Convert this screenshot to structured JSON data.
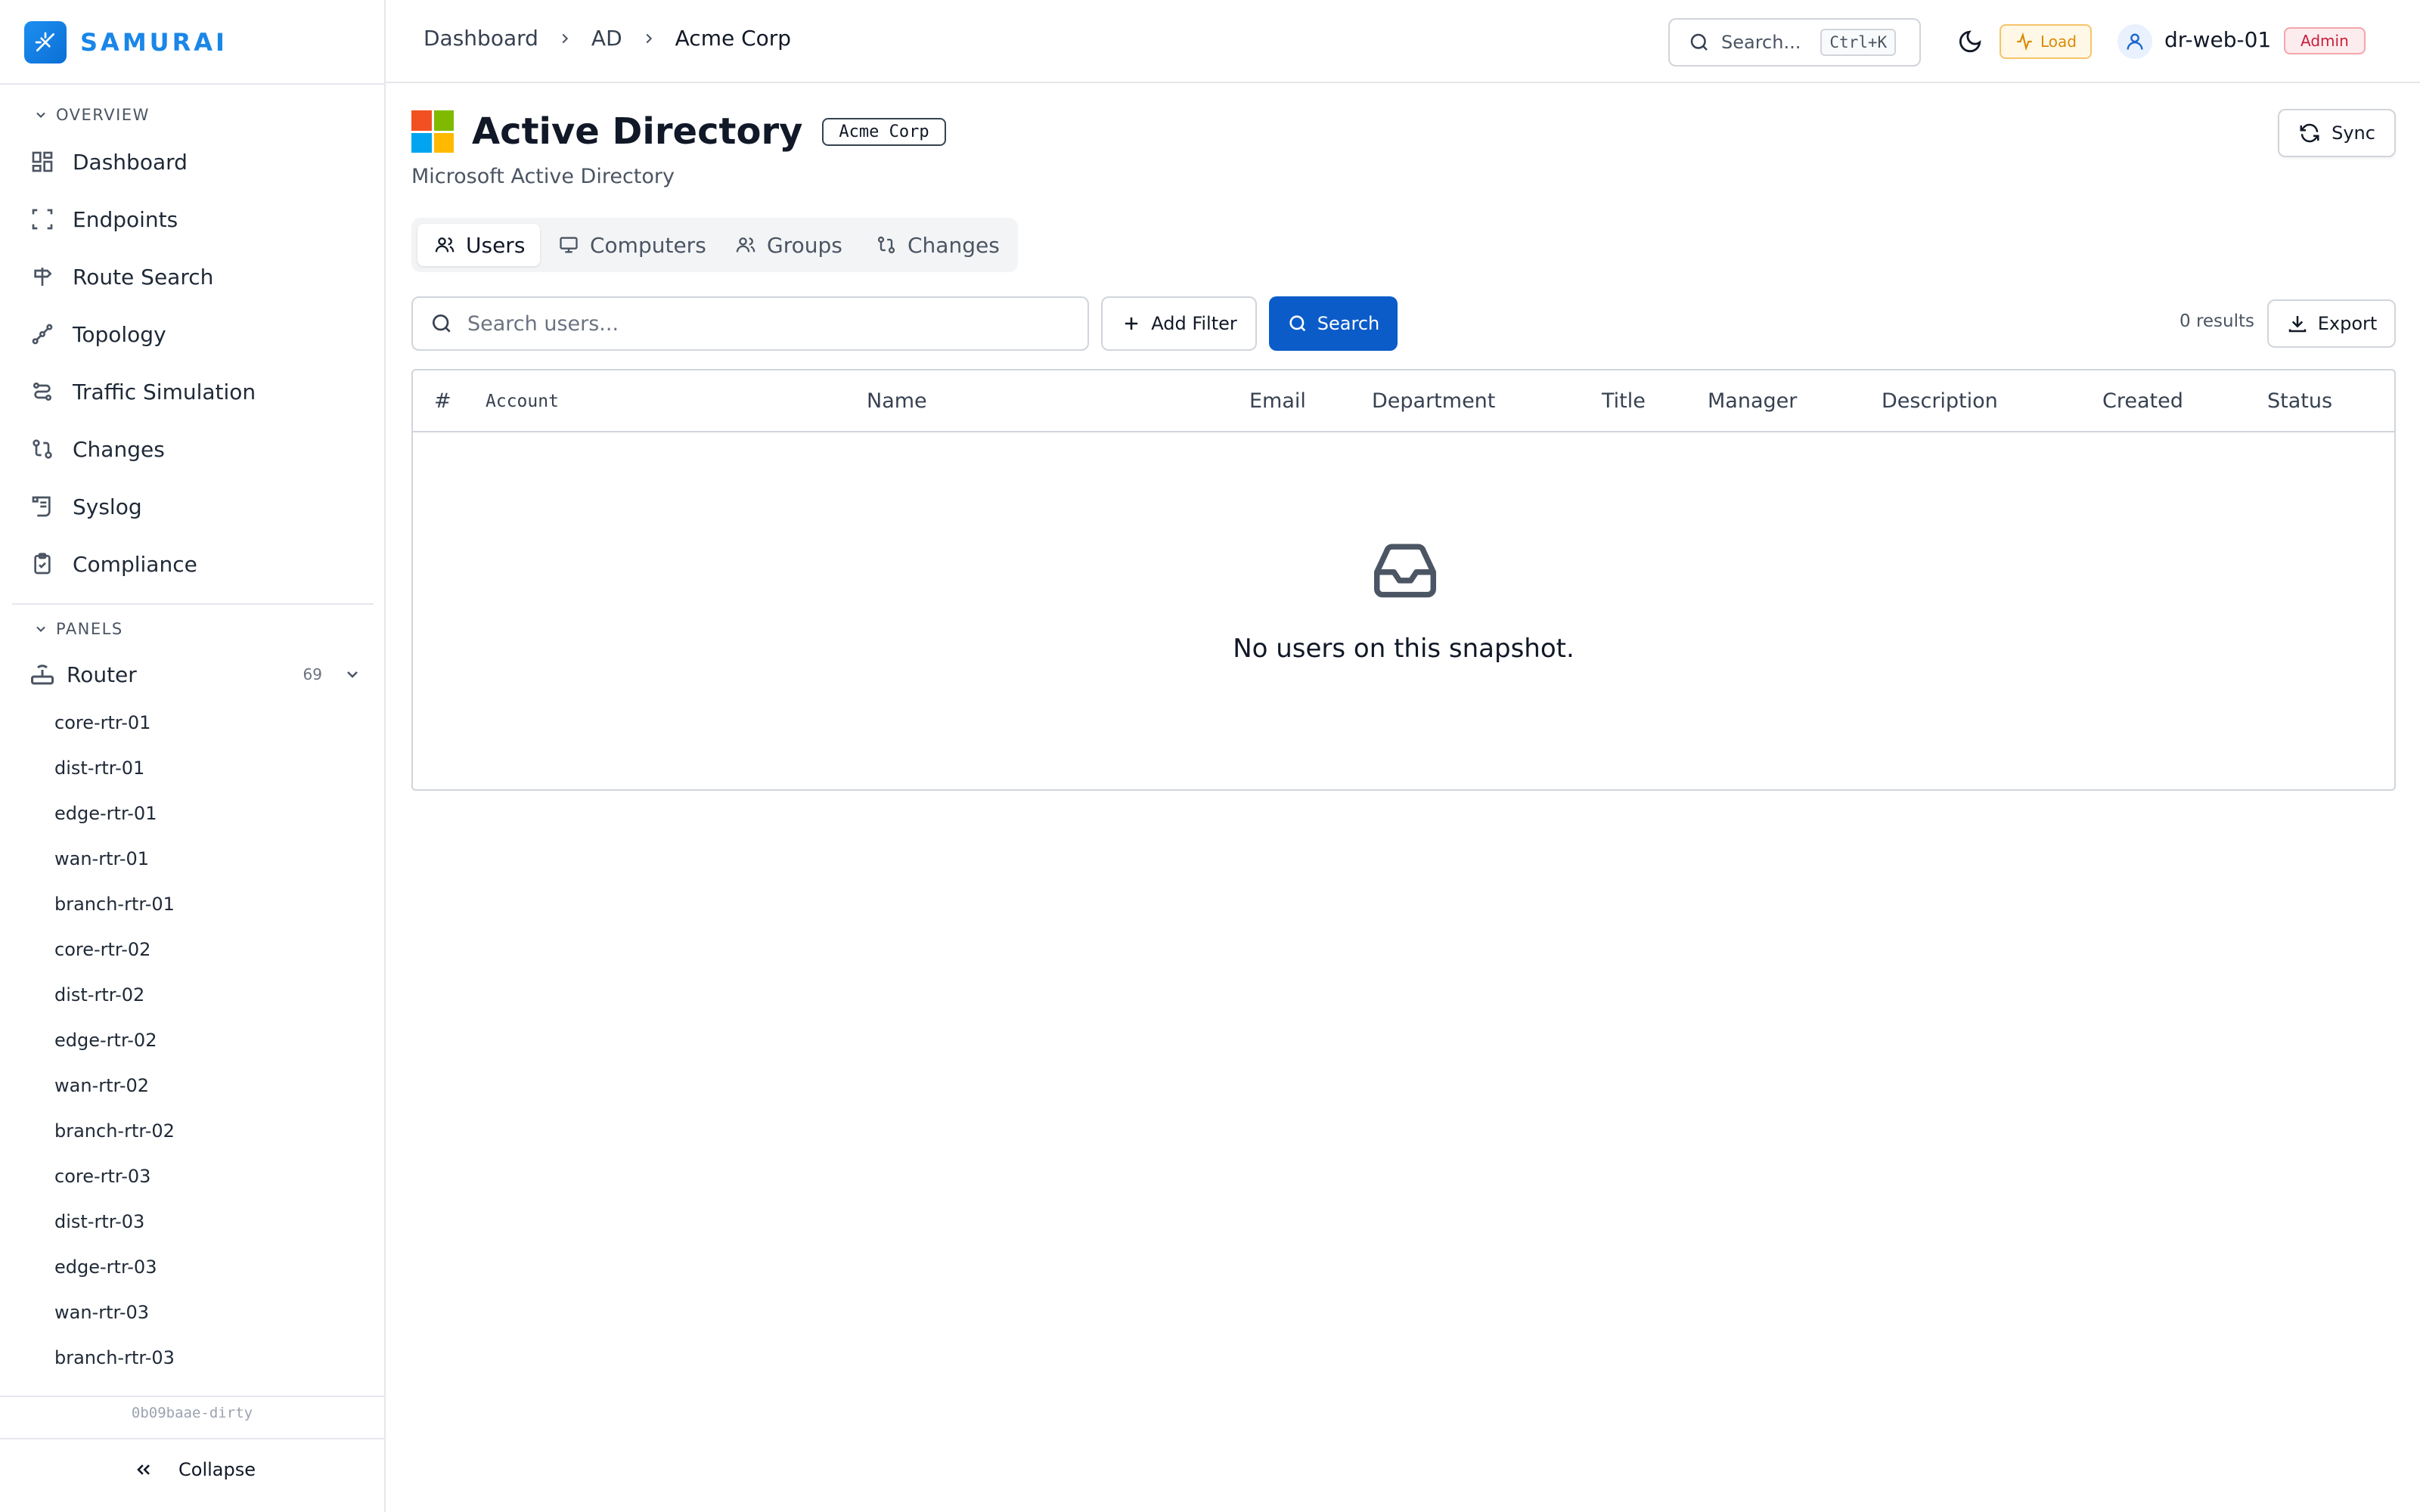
{
  "brand": {
    "name": "SAMURAI"
  },
  "sidebar": {
    "overview_label": "OVERVIEW",
    "nav": [
      {
        "label": "Dashboard",
        "icon": "dashboard-grid-icon"
      },
      {
        "label": "Endpoints",
        "icon": "scan-frame-icon"
      },
      {
        "label": "Route Search",
        "icon": "signpost-icon"
      },
      {
        "label": "Topology",
        "icon": "topology-icon"
      },
      {
        "label": "Traffic Simulation",
        "icon": "traffic-icon"
      },
      {
        "label": "Changes",
        "icon": "git-compare-icon"
      },
      {
        "label": "Syslog",
        "icon": "scroll-icon"
      },
      {
        "label": "Compliance",
        "icon": "clipboard-check-icon"
      }
    ],
    "panels_label": "PANELS",
    "router": {
      "label": "Router",
      "count": "69"
    },
    "routers": [
      "core-rtr-01",
      "dist-rtr-01",
      "edge-rtr-01",
      "wan-rtr-01",
      "branch-rtr-01",
      "core-rtr-02",
      "dist-rtr-02",
      "edge-rtr-02",
      "wan-rtr-02",
      "branch-rtr-02",
      "core-rtr-03",
      "dist-rtr-03",
      "edge-rtr-03",
      "wan-rtr-03",
      "branch-rtr-03"
    ],
    "version": "0b09baae-dirty",
    "collapse_label": "Collapse"
  },
  "header": {
    "breadcrumb": [
      "Dashboard",
      "AD",
      "Acme Corp"
    ],
    "search_label": "Search...",
    "search_shortcut": "Ctrl+K",
    "load_label": "Load",
    "user_name": "dr-web-01",
    "role": "Admin"
  },
  "page": {
    "title": "Active Directory",
    "tenant": "Acme Corp",
    "subtitle": "Microsoft Active Directory",
    "sync_label": "Sync",
    "tabs": [
      {
        "label": "Users",
        "active": true
      },
      {
        "label": "Computers",
        "active": false
      },
      {
        "label": "Groups",
        "active": false
      },
      {
        "label": "Changes",
        "active": false
      }
    ],
    "search_placeholder": "Search users...",
    "add_filter_label": "Add Filter",
    "search_button_label": "Search",
    "results_count": "0 results",
    "export_label": "Export"
  },
  "table": {
    "columns": [
      "#",
      "Account",
      "Name",
      "Email",
      "Department",
      "Title",
      "Manager",
      "Description",
      "Created",
      "Status"
    ],
    "empty_message": "No users on this snapshot."
  },
  "colors": {
    "brand": "#1a86e8",
    "primary_button": "#0b5cc9",
    "load_warning": "#d98a06",
    "admin_badge": "#c81e3a",
    "ms_red": "#f25022",
    "ms_green": "#7fba00",
    "ms_blue": "#00a4ef",
    "ms_yellow": "#ffb900"
  }
}
